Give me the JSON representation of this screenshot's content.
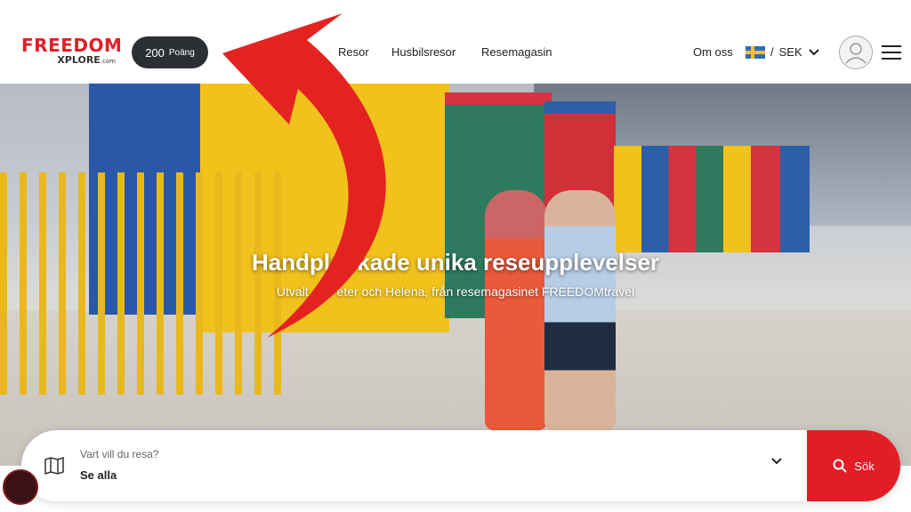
{
  "header": {
    "logo_main": "FREEDOM",
    "logo_sub": "XPLORE",
    "logo_dot": ".com",
    "points_value": "200",
    "points_label": "Poäng",
    "nav": [
      "Resor",
      "Husbilsresor",
      "Resemagasin"
    ],
    "about": "Om oss",
    "currency": "SEK",
    "separator": "/"
  },
  "hero": {
    "title": "Handplockade unika reseupplevelser",
    "subtitle": "Utvalt av Peter och Helena, från resemagasinet FREEDOMtravel"
  },
  "search": {
    "question": "Vart vill du resa?",
    "value": "Se alla",
    "button": "Sök"
  },
  "colors": {
    "brand_red": "#e31d26",
    "dark_pill": "#2b2f33"
  }
}
